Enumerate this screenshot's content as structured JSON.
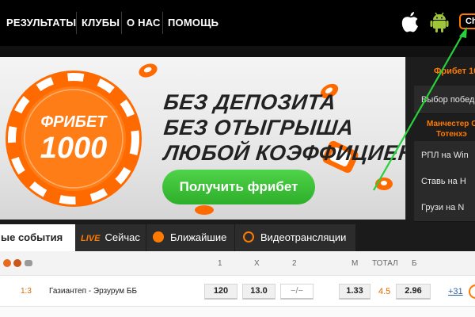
{
  "nav": {
    "items": [
      "РЕЗУЛЬТАТЫ",
      "КЛУБЫ",
      "О НАС",
      "ПОМОЩЬ"
    ],
    "chat_label": "Ch",
    "apple_icon": "apple-icon",
    "android_icon": "android-icon"
  },
  "banner": {
    "chip_top": "ФРИБЕТ",
    "chip_value": "1000",
    "slogan": [
      "БЕЗ ДЕПОЗИТА",
      "БЕЗ ОТЫГРЫША",
      "ЛЮБОЙ КОЭФФИЦИЕНТ"
    ],
    "cta": "Получить фрибет",
    "colors": {
      "chip": "#ff6a00",
      "cta": "#34b52e"
    }
  },
  "sidebar": {
    "title": "Фрибет 10",
    "items": [
      "Выбор победи",
      "Манчестер С",
      "Тотенхэ",
      "РПЛ на Win",
      "Ставь на Н",
      "Грузи на N"
    ]
  },
  "tabs": {
    "active": "ые события",
    "live_tag": "LIVE",
    "live": "Сейчас",
    "upcoming": "Ближайшие",
    "video": "Видеотрансляции"
  },
  "odds": {
    "headers": {
      "h1": "1",
      "hx": "X",
      "h2": "2",
      "hm": "М",
      "htotal": "ТОТАЛ",
      "hb": "Б"
    },
    "row": {
      "score": "1:3",
      "match": "Газиантеп - Эрзурум ББ",
      "w1": "120",
      "x": "13.0",
      "w2": "−/−",
      "m": "1.33",
      "total": "4.5",
      "b": "2.96",
      "more": "+31"
    }
  }
}
